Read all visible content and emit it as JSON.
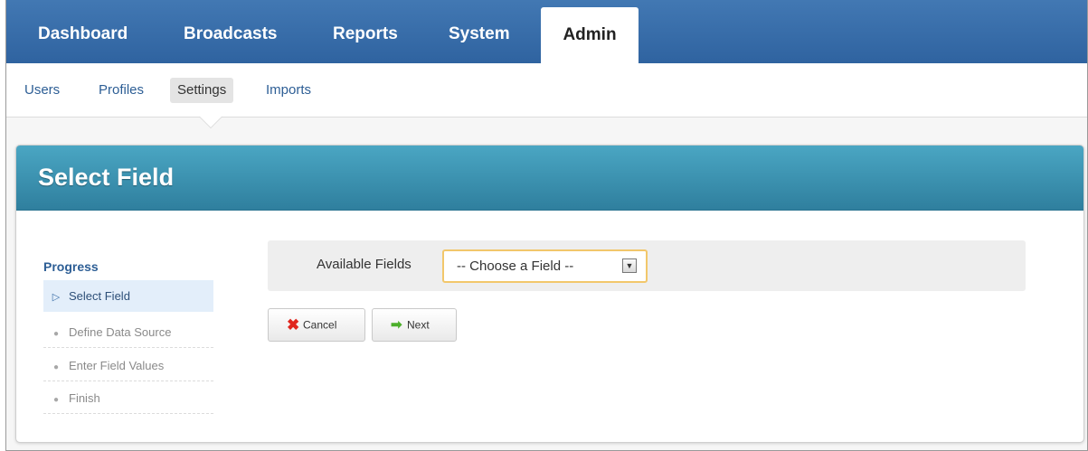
{
  "topnav": {
    "tabs": [
      {
        "label": "Dashboard",
        "active": false
      },
      {
        "label": "Broadcasts",
        "active": false
      },
      {
        "label": "Reports",
        "active": false
      },
      {
        "label": "System",
        "active": false
      },
      {
        "label": "Admin",
        "active": true
      }
    ]
  },
  "subnav": {
    "items": [
      {
        "label": "Users",
        "active": false
      },
      {
        "label": "Profiles",
        "active": false
      },
      {
        "label": "Settings",
        "active": true
      },
      {
        "label": "Imports",
        "active": false
      }
    ]
  },
  "panel": {
    "title": "Select Field"
  },
  "progress": {
    "title": "Progress",
    "steps": [
      {
        "label": "Select Field",
        "state": "current"
      },
      {
        "label": "Define Data Source",
        "state": "pending"
      },
      {
        "label": "Enter Field Values",
        "state": "pending"
      },
      {
        "label": "Finish",
        "state": "pending"
      }
    ]
  },
  "form": {
    "field_label": "Available Fields",
    "select_value": "-- Choose a Field --"
  },
  "buttons": {
    "cancel_label": "Cancel",
    "next_label": "Next"
  },
  "colors": {
    "nav_blue": "#3a6fad",
    "panel_header": "#3b93b4",
    "select_border": "#f2c76b",
    "cancel_icon": "#e0261e",
    "next_icon": "#4caf2a"
  },
  "icons": {
    "cancel": "x-icon",
    "next": "arrow-right-icon",
    "current_step": "triangle-right-icon",
    "pending_step": "circle-icon",
    "dropdown": "chevron-down-icon"
  }
}
